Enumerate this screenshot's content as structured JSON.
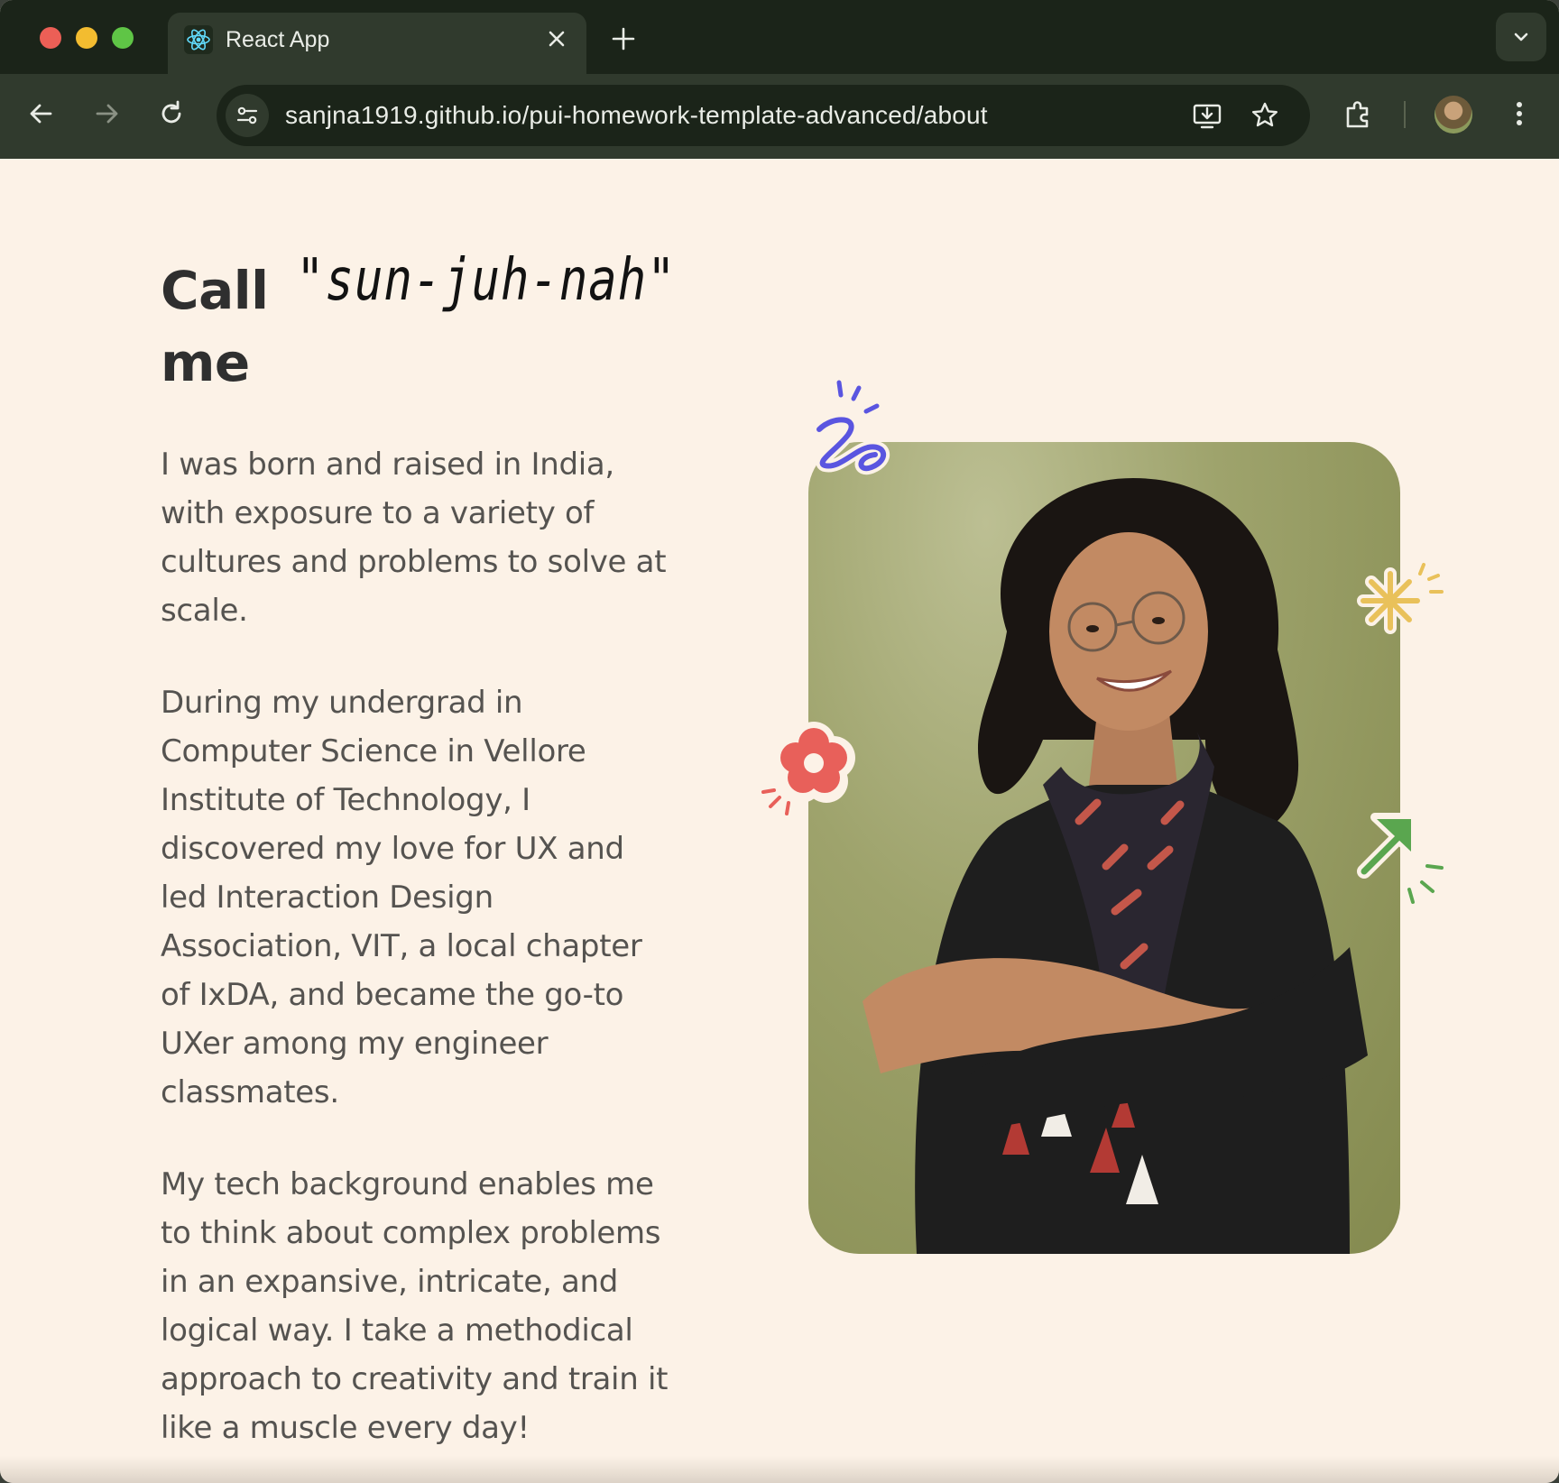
{
  "browser": {
    "tab_title": "React App",
    "url": "sanjna1919.github.io/pui-homework-template-advanced/about"
  },
  "page": {
    "heading_call": "Call",
    "heading_me": "me",
    "heading_pronunciation": "\"sun-juh-nah\"",
    "paragraphs": [
      "I was born and raised in India, with exposure to a variety of cultures and problems to solve at scale.",
      "During my undergrad in Computer Science in Vellore Institute of Technology, I discovered my love for UX and led Interaction Design Association, VIT, a local chapter of IxDA, and became the go-to UXer among my engineer classmates.",
      "My tech background enables me to think about complex problems in an expansive, intricate, and logical way. I take a methodical approach to creativity and train it like a muscle every day!"
    ]
  },
  "colors": {
    "background": "#fcf2e7",
    "squiggle": "#5a55e0",
    "sparkle": "#e9c15a",
    "flower": "#e8605a",
    "arrow": "#5aa64f"
  }
}
